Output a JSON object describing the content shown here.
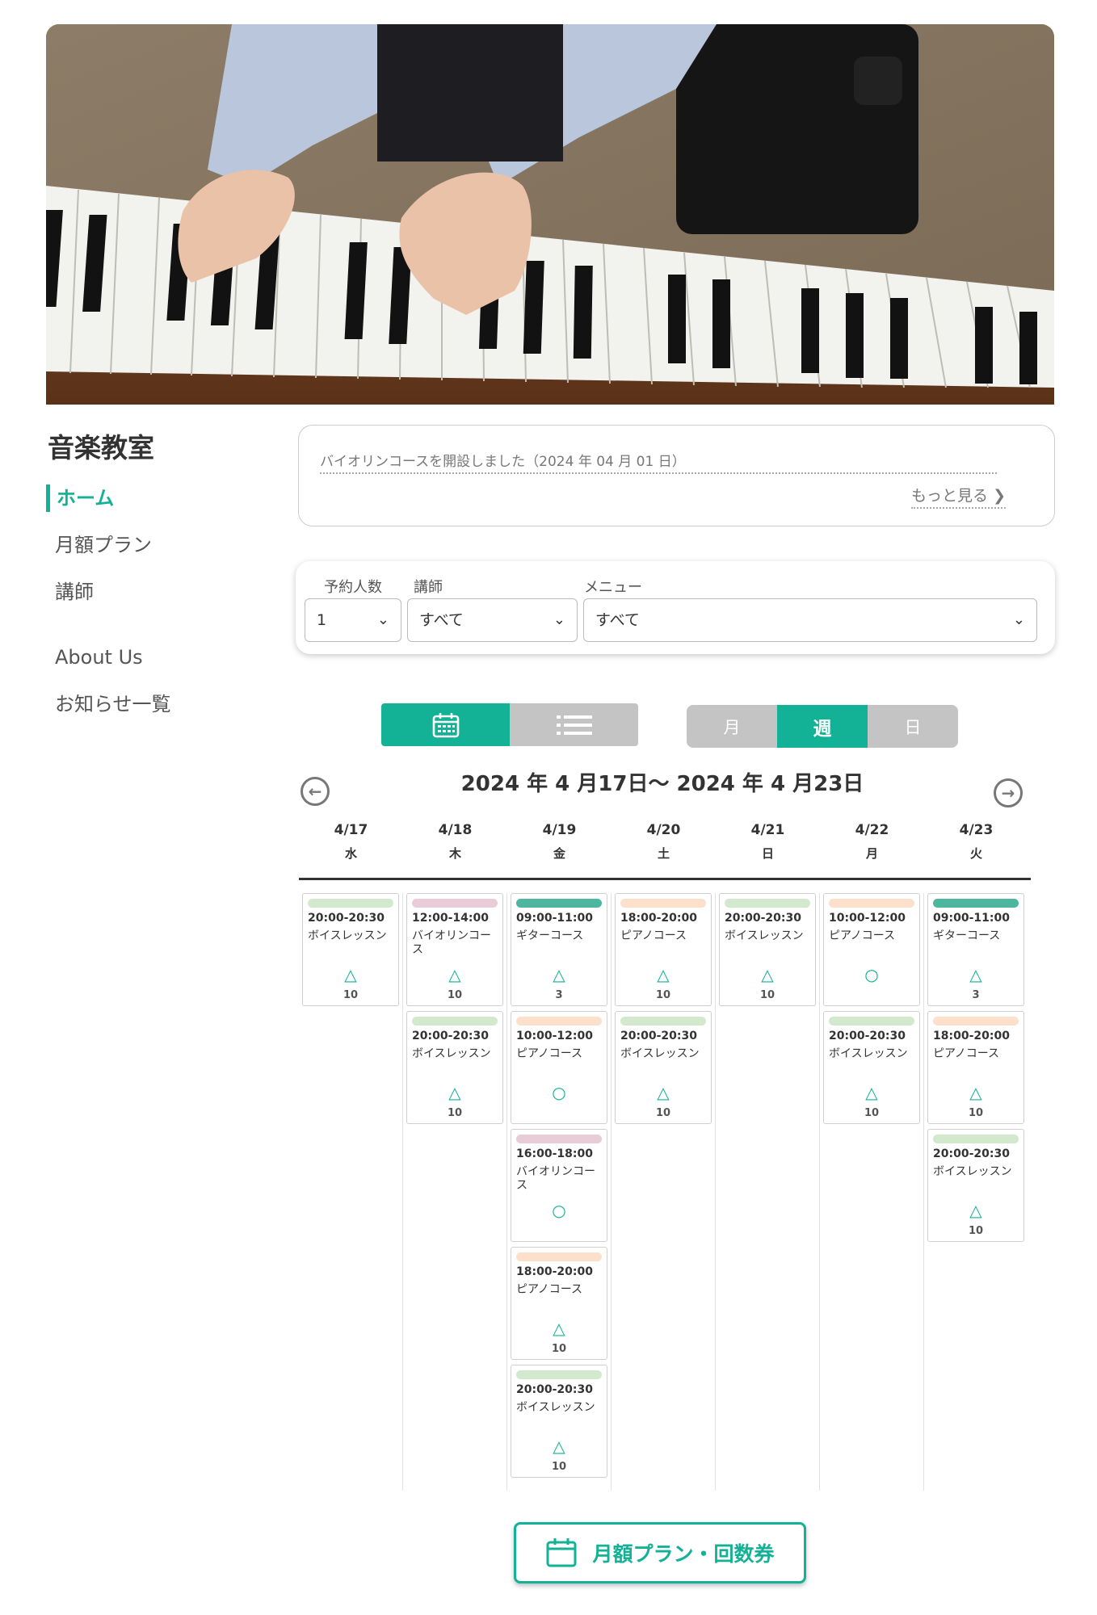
{
  "site": {
    "title": "音楽教室"
  },
  "nav": [
    {
      "label": "ホーム",
      "active": true
    },
    {
      "label": "月額プラン",
      "active": false
    },
    {
      "label": "講師",
      "active": false
    },
    {
      "label": "About Us",
      "active": false
    },
    {
      "label": "お知らせ一覧",
      "active": false
    }
  ],
  "news": {
    "text": "バイオリンコースを開設しました（2024 年 04 月 01 日）",
    "more": "もっと見る"
  },
  "filters": {
    "people": {
      "label": "予約人数",
      "value": "1"
    },
    "teacher": {
      "label": "講師",
      "value": "すべて"
    },
    "menu": {
      "label": "メニュー",
      "value": "すべて"
    }
  },
  "view_toggle": {
    "calendar_icon": "calendar-icon",
    "list_icon": "list-icon",
    "active": "calendar"
  },
  "range_toggle": {
    "month": "月",
    "week": "週",
    "day": "日",
    "active": "week"
  },
  "period": {
    "label": "2024 年 4 月17日〜 2024 年 4 月23日"
  },
  "course_colors": {
    "voice": "#d2e9cd",
    "violin": "#e8cdd9",
    "guitar": "#4cb79e",
    "piano": "#fce0cc"
  },
  "days": [
    {
      "date": "4/17",
      "weekday": "水",
      "slots": [
        {
          "time": "20:00-20:30",
          "name": "ボイスレッスン",
          "mark": "△",
          "count": "10",
          "course": "voice"
        }
      ]
    },
    {
      "date": "4/18",
      "weekday": "木",
      "slots": [
        {
          "time": "12:00-14:00",
          "name": "バイオリンコース",
          "mark": "△",
          "count": "10",
          "course": "violin"
        },
        {
          "time": "20:00-20:30",
          "name": "ボイスレッスン",
          "mark": "△",
          "count": "10",
          "course": "voice"
        }
      ]
    },
    {
      "date": "4/19",
      "weekday": "金",
      "slots": [
        {
          "time": "09:00-11:00",
          "name": "ギターコース",
          "mark": "△",
          "count": "3",
          "course": "guitar"
        },
        {
          "time": "10:00-12:00",
          "name": "ピアノコース",
          "mark": "○",
          "count": "",
          "course": "piano"
        },
        {
          "time": "16:00-18:00",
          "name": "バイオリンコース",
          "mark": "○",
          "count": "",
          "course": "violin"
        },
        {
          "time": "18:00-20:00",
          "name": "ピアノコース",
          "mark": "△",
          "count": "10",
          "course": "piano"
        },
        {
          "time": "20:00-20:30",
          "name": "ボイスレッスン",
          "mark": "△",
          "count": "10",
          "course": "voice"
        }
      ]
    },
    {
      "date": "4/20",
      "weekday": "土",
      "slots": [
        {
          "time": "18:00-20:00",
          "name": "ピアノコース",
          "mark": "△",
          "count": "10",
          "course": "piano"
        },
        {
          "time": "20:00-20:30",
          "name": "ボイスレッスン",
          "mark": "△",
          "count": "10",
          "course": "voice"
        }
      ]
    },
    {
      "date": "4/21",
      "weekday": "日",
      "slots": [
        {
          "time": "20:00-20:30",
          "name": "ボイスレッスン",
          "mark": "△",
          "count": "10",
          "course": "voice"
        }
      ]
    },
    {
      "date": "4/22",
      "weekday": "月",
      "slots": [
        {
          "time": "10:00-12:00",
          "name": "ピアノコース",
          "mark": "○",
          "count": "",
          "course": "piano"
        },
        {
          "time": "20:00-20:30",
          "name": "ボイスレッスン",
          "mark": "△",
          "count": "10",
          "course": "voice"
        }
      ]
    },
    {
      "date": "4/23",
      "weekday": "火",
      "slots": [
        {
          "time": "09:00-11:00",
          "name": "ギターコース",
          "mark": "△",
          "count": "3",
          "course": "guitar"
        },
        {
          "time": "18:00-20:00",
          "name": "ピアノコース",
          "mark": "△",
          "count": "10",
          "course": "piano"
        },
        {
          "time": "20:00-20:30",
          "name": "ボイスレッスン",
          "mark": "△",
          "count": "10",
          "course": "voice"
        }
      ]
    }
  ],
  "plan_button": {
    "label": "月額プラン・回数券",
    "icon": "calendar-icon"
  }
}
